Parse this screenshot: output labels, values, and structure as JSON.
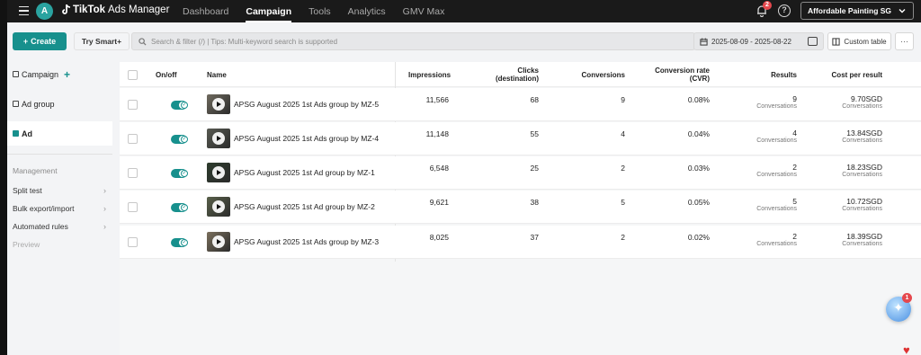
{
  "topnav": {
    "app_name_bold": "TikTok",
    "app_name_rest": "Ads Manager",
    "avatar_letter": "A",
    "links": [
      {
        "label": "Dashboard",
        "active": false
      },
      {
        "label": "Campaign",
        "active": true
      },
      {
        "label": "Tools",
        "active": false
      },
      {
        "label": "Analytics",
        "active": false
      },
      {
        "label": "GMV Max",
        "active": false
      }
    ],
    "notification_count": "2",
    "account_name": "Affordable Painting SG"
  },
  "toolbar": {
    "create_label": "Create",
    "try_smart_label": "Try Smart+",
    "search_placeholder": "Search & filter (/) | Tips: Multi-keyword search is supported",
    "date_range": "2025-08-09 - 2025-08-22",
    "custom_table_label": "Custom table",
    "more_label": "···"
  },
  "sidebar": {
    "levels": [
      {
        "label": "Campaign",
        "active": false
      },
      {
        "label": "Ad group",
        "active": false
      },
      {
        "label": "Ad",
        "active": true
      }
    ],
    "management_heading": "Management",
    "management_items": [
      {
        "label": "Split test",
        "muted": false
      },
      {
        "label": "Bulk export/import",
        "muted": false
      },
      {
        "label": "Automated rules",
        "muted": false
      },
      {
        "label": "Preview",
        "muted": true
      }
    ]
  },
  "table": {
    "headers": {
      "onoff": "On/off",
      "name": "Name",
      "impressions": "Impressions",
      "clicks_1": "Clicks",
      "clicks_2": "(destination)",
      "conversions": "Conversions",
      "cvr_1": "Conversion rate",
      "cvr_2": "(CVR)",
      "results": "Results",
      "cost_per_result": "Cost per result"
    },
    "rows": [
      {
        "name": "APSG August 2025 1st Ads group by MZ-5",
        "impressions": "11,566",
        "clicks": "68",
        "conversions": "9",
        "cvr": "0.08%",
        "results": "9",
        "results_sub": "Conversations",
        "cpr": "9.70SGD",
        "cpr_sub": "Conversations",
        "thumb_color": "#6f6a5e"
      },
      {
        "name": "APSG August 2025 1st Ads group by MZ-4",
        "impressions": "11,148",
        "clicks": "55",
        "conversions": "4",
        "cvr": "0.04%",
        "results": "4",
        "results_sub": "Conversations",
        "cpr": "13.84SGD",
        "cpr_sub": "Conversations",
        "thumb_color": "#585a52"
      },
      {
        "name": "APSG August 2025 1st Ad group by MZ-1",
        "impressions": "6,548",
        "clicks": "25",
        "conversions": "2",
        "cvr": "0.03%",
        "results": "2",
        "results_sub": "Conversations",
        "cpr": "18.23SGD",
        "cpr_sub": "Conversations",
        "thumb_color": "#2d3b2c"
      },
      {
        "name": "APSG August 2025 1st Ad group by MZ-2",
        "impressions": "9,621",
        "clicks": "38",
        "conversions": "5",
        "cvr": "0.05%",
        "results": "5",
        "results_sub": "Conversations",
        "cpr": "10.72SGD",
        "cpr_sub": "Conversations",
        "thumb_color": "#59604a"
      },
      {
        "name": "APSG August 2025 1st Ads group by MZ-3",
        "impressions": "8,025",
        "clicks": "37",
        "conversions": "2",
        "cvr": "0.02%",
        "results": "2",
        "results_sub": "Conversations",
        "cpr": "18.39SGD",
        "cpr_sub": "Conversations",
        "thumb_color": "#7a6f5c"
      }
    ]
  },
  "assistant_badge": "1",
  "colors": {
    "accent": "#17908d",
    "nav_bg": "#1a1a1a",
    "badge": "#e5484d"
  }
}
